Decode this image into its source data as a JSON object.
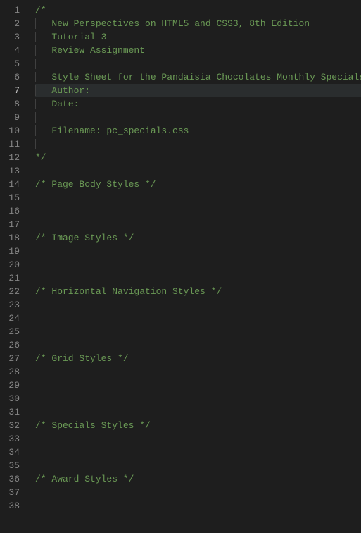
{
  "activeLine": 7,
  "lines": [
    {
      "num": 1,
      "indent": 0,
      "text": "/*",
      "class": "comment"
    },
    {
      "num": 2,
      "indent": 1,
      "text": "New Perspectives on HTML5 and CSS3, 8th Edition",
      "class": "comment"
    },
    {
      "num": 3,
      "indent": 1,
      "text": "Tutorial 3",
      "class": "comment"
    },
    {
      "num": 4,
      "indent": 1,
      "text": "Review Assignment",
      "class": "comment"
    },
    {
      "num": 5,
      "indent": 1,
      "text": "",
      "class": "comment"
    },
    {
      "num": 6,
      "indent": 1,
      "text": "Style Sheet for the Pandaisia Chocolates Monthly Specials",
      "class": "comment"
    },
    {
      "num": 7,
      "indent": 1,
      "text": "Author: ",
      "class": "comment"
    },
    {
      "num": 8,
      "indent": 1,
      "text": "Date:  ",
      "class": "comment"
    },
    {
      "num": 9,
      "indent": 1,
      "text": "",
      "class": "comment"
    },
    {
      "num": 10,
      "indent": 1,
      "text": "Filename: pc_specials.css",
      "class": "comment"
    },
    {
      "num": 11,
      "indent": 1,
      "text": "",
      "class": "comment"
    },
    {
      "num": 12,
      "indent": 0,
      "text": "*/",
      "class": "comment"
    },
    {
      "num": 13,
      "indent": 0,
      "text": "",
      "class": ""
    },
    {
      "num": 14,
      "indent": 0,
      "text": "/* Page Body Styles */",
      "class": "comment"
    },
    {
      "num": 15,
      "indent": 0,
      "text": "",
      "class": ""
    },
    {
      "num": 16,
      "indent": 0,
      "text": "",
      "class": ""
    },
    {
      "num": 17,
      "indent": 0,
      "text": "",
      "class": ""
    },
    {
      "num": 18,
      "indent": 0,
      "text": "/* Image Styles */",
      "class": "comment"
    },
    {
      "num": 19,
      "indent": 0,
      "text": "",
      "class": ""
    },
    {
      "num": 20,
      "indent": 0,
      "text": "",
      "class": ""
    },
    {
      "num": 21,
      "indent": 0,
      "text": "",
      "class": ""
    },
    {
      "num": 22,
      "indent": 0,
      "text": "/* Horizontal Navigation Styles */",
      "class": "comment"
    },
    {
      "num": 23,
      "indent": 0,
      "text": "",
      "class": ""
    },
    {
      "num": 24,
      "indent": 0,
      "text": "",
      "class": ""
    },
    {
      "num": 25,
      "indent": 0,
      "text": "",
      "class": ""
    },
    {
      "num": 26,
      "indent": 0,
      "text": "",
      "class": ""
    },
    {
      "num": 27,
      "indent": 0,
      "text": "/* Grid Styles */",
      "class": "comment"
    },
    {
      "num": 28,
      "indent": 0,
      "text": "",
      "class": ""
    },
    {
      "num": 29,
      "indent": 0,
      "text": "",
      "class": ""
    },
    {
      "num": 30,
      "indent": 0,
      "text": "",
      "class": ""
    },
    {
      "num": 31,
      "indent": 0,
      "text": "",
      "class": ""
    },
    {
      "num": 32,
      "indent": 0,
      "text": "/* Specials Styles */",
      "class": "comment"
    },
    {
      "num": 33,
      "indent": 0,
      "text": "",
      "class": ""
    },
    {
      "num": 34,
      "indent": 0,
      "text": "",
      "class": ""
    },
    {
      "num": 35,
      "indent": 0,
      "text": "",
      "class": ""
    },
    {
      "num": 36,
      "indent": 0,
      "text": "/* Award Styles */",
      "class": "comment"
    },
    {
      "num": 37,
      "indent": 0,
      "text": "",
      "class": ""
    },
    {
      "num": 38,
      "indent": 0,
      "text": "",
      "class": ""
    }
  ]
}
